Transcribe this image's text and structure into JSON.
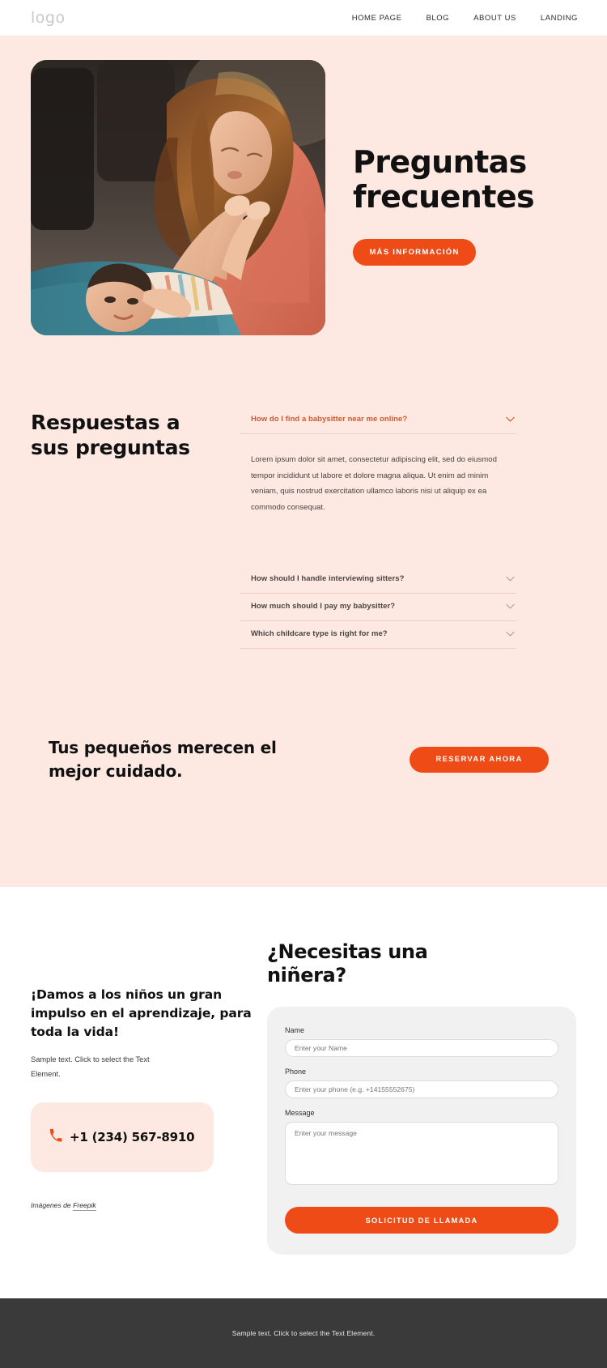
{
  "colors": {
    "accent": "#ef4b16",
    "hero_bg": "#fde9e2",
    "footer_bg": "#3a3a3a",
    "form_bg": "#f1f1f1",
    "question_open": "#d4582c"
  },
  "header": {
    "logo": "logo",
    "nav": [
      {
        "label": "HOME PAGE"
      },
      {
        "label": "BLOG"
      },
      {
        "label": "ABOUT US"
      },
      {
        "label": "LANDING"
      }
    ]
  },
  "hero": {
    "title_line1": "Preguntas",
    "title_line2": "frecuentes",
    "cta_label": "MÁS INFORMACIÓN",
    "image_alt": "mother-playing-with-baby"
  },
  "faq": {
    "heading_line1": "Respuestas a",
    "heading_line2": "sus preguntas",
    "items": [
      {
        "question": "How do I find a babysitter near me online?",
        "open": true,
        "answer": "Lorem ipsum dolor sit amet, consectetur adipiscing elit, sed do eiusmod tempor incididunt ut labore et dolore magna aliqua. Ut enim ad minim veniam, quis nostrud exercitation ullamco laboris nisi ut aliquip ex ea commodo consequat."
      },
      {
        "question": "How should I handle interviewing sitters?",
        "open": false,
        "answer": ""
      },
      {
        "question": "How much should I pay my babysitter?",
        "open": false,
        "answer": ""
      },
      {
        "question": "Which childcare type is right for me?",
        "open": false,
        "answer": ""
      }
    ]
  },
  "cta_band": {
    "title_line1": "Tus pequeños merecen el",
    "title_line2": "mejor cuidado.",
    "button_label": "RESERVAR AHORA"
  },
  "contact": {
    "left": {
      "heading": "¡Damos a los niños un gran impulso en el aprendizaje, para toda la vida!",
      "sample_text": "Sample text. Click to select the Text Element.",
      "phone": "+1 (234) 567-8910",
      "credit_prefix": "Imágenes de ",
      "credit_link": "Freepik"
    },
    "form": {
      "heading": "¿Necesitas una niñera?",
      "fields": [
        {
          "label": "Name",
          "placeholder": "Enter your Name",
          "value": ""
        },
        {
          "label": "Phone",
          "placeholder": "Enter your phone (e.g. +14155552675)",
          "value": ""
        },
        {
          "label": "Message",
          "placeholder": "Enter your message",
          "value": ""
        }
      ],
      "submit_label": "SOLICITUD DE LLAMADA"
    }
  },
  "footer": {
    "text": "Sample text. Click to select the Text Element."
  }
}
